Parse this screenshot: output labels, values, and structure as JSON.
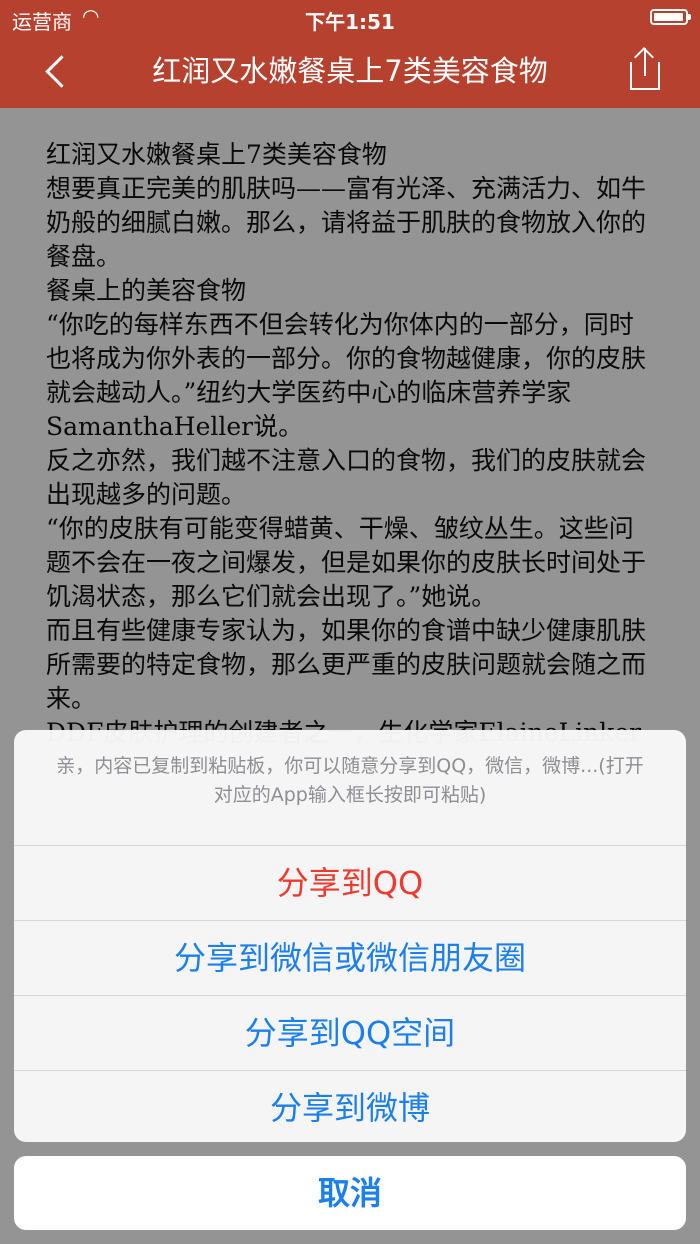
{
  "status_bar": {
    "carrier": "运营商",
    "time": "下午1:51"
  },
  "nav": {
    "title": "红润又水嫩餐桌上7类美容食物"
  },
  "article": {
    "lines": [
      "红润又水嫩餐桌上7类美容食物",
      "想要真正完美的肌肤吗——富有光泽、充满活力、如牛奶般的细腻白嫩。那么，请将益于肌肤的食物放入你的餐盘。",
      "餐桌上的美容食物",
      "“你吃的每样东西不但会转化为你体内的一部分，同时也将成为你外表的一部分。你的食物越健康，你的皮肤就会越动人。”纽约大学医药中心的临床营养学家SamanthaHeller说。",
      "反之亦然，我们越不注意入口的食物，我们的皮肤就会出现越多的问题。",
      "“你的皮肤有可能变得蜡黄、干燥、皱纹丛生。这些问题不会在一夜之间爆发，但是如果你的皮肤长时间处于饥渴状态，那么它们就会出现了。”她说。",
      "而且有些健康专家认为，如果你的食谱中缺少健康肌肤所需要的特定食物，那么更严重的皮肤问题就会随之而来。",
      "DDF皮肤护理的创建者之一，生化学家ElaineLinker"
    ]
  },
  "action_sheet": {
    "message": "亲，内容已复制到粘贴板，你可以随意分享到QQ，微信，微博...(打开对应的App输入框长按即可粘贴)",
    "share_qq": "分享到QQ",
    "share_wechat": "分享到微信或微信朋友圈",
    "share_qzone": "分享到QQ空间",
    "share_weibo": "分享到微博",
    "cancel": "取消"
  },
  "colors": {
    "nav_bg": "#b5412e",
    "action_blue": "#1b7ff0",
    "action_red": "#ef3b2f"
  },
  "icons": [
    "wifi-icon",
    "battery-icon",
    "back-chevron-icon",
    "share-icon"
  ]
}
